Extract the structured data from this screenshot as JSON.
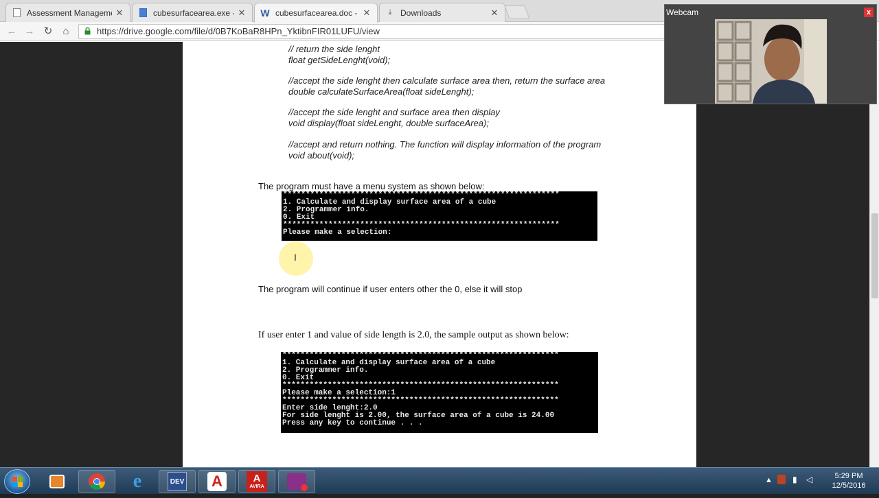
{
  "browser": {
    "tabs": [
      {
        "label": "Assessment Managemen",
        "icon": "document-icon"
      },
      {
        "label": "cubesurfacearea.exe - G",
        "icon": "document-icon"
      },
      {
        "label": "cubesurfacearea.doc - G",
        "icon": "word-icon"
      },
      {
        "label": "Downloads",
        "icon": "download-icon"
      }
    ],
    "url": "https://drive.google.com/file/d/0B7KoBaR8HPn_YktibnFIR01LUFU/view"
  },
  "doc": {
    "code_blocks": [
      [
        "// return the side lenght",
        "float getSideLenght(void);"
      ],
      [
        "//accept the side lenght then calculate surface area then, return the surface area",
        "double calculateSurfaceArea(float sideLenght);"
      ],
      [
        "//accept the side lenght and surface area  then display",
        "void display(float sideLenght, double surfaceArea);"
      ],
      [
        "//accept and return nothing. The function will display information of the program",
        "void about(void);"
      ]
    ],
    "menu_intro": "The program must have a menu system as shown below:",
    "console1": "*************************************************************\n1. Calculate and display surface area of a cube\n2. Programmer info.\n0. Exit\n*************************************************************\nPlease make a selection:",
    "continue_text": "The program will continue if user enters other the 0, else it will stop",
    "sample_intro": "If user enter 1 and value of side length is 2.0,  the sample output as shown below:",
    "console2": "*************************************************************\n1. Calculate and display surface area of a cube\n2. Programmer info.\n0. Exit\n*************************************************************\nPlease make a selection:1\n*************************************************************\nEnter side lenght:2.0\nFor side lenght is 2.00, the surface area of a cube is 24.00\nPress any key to continue . . ."
  },
  "webcam": {
    "title": "Webcam",
    "close": "x"
  },
  "taskbar": {
    "apps": [
      "media-player-icon",
      "chrome-icon",
      "internet-explorer-icon",
      "dev-cpp-icon",
      "avira-icon",
      "avira-antivirus-icon",
      "webcam-app-icon"
    ],
    "dev_label": "DEV",
    "avira_label": "AVIRA",
    "time": "5:29 PM",
    "date": "12/5/2016"
  },
  "colors": {
    "console_bg": "#000000",
    "console_fg": "#e8e8e8",
    "taskbar": "#2a4866"
  }
}
